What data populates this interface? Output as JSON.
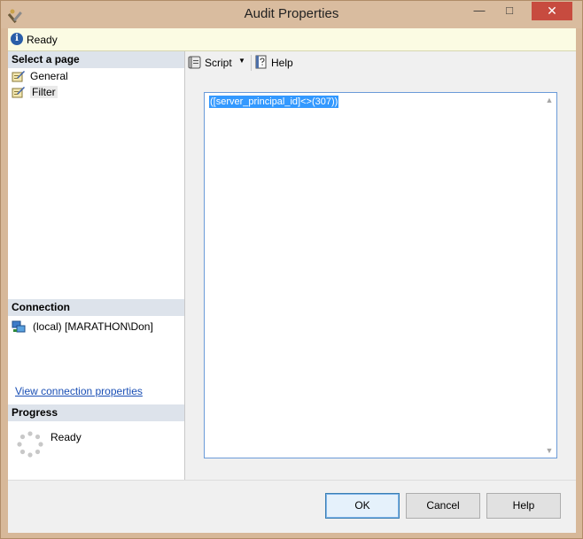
{
  "window": {
    "title": "Audit Properties",
    "close_glyph": "✕",
    "minimize_glyph": "—",
    "maximize_glyph": "□"
  },
  "status": {
    "icon": "info-icon",
    "text": "Ready"
  },
  "left_pane": {
    "select_page_header": "Select a page",
    "pages": [
      {
        "label": "General",
        "icon": "page-icon"
      },
      {
        "label": "Filter",
        "icon": "page-icon",
        "selected": true
      }
    ],
    "connection_header": "Connection",
    "connection_server": "(local) [MARATHON\\Don]",
    "view_connection_link": "View connection properties",
    "progress_header": "Progress",
    "progress_status": "Ready"
  },
  "toolbar": {
    "script_label": "Script",
    "help_label": "Help"
  },
  "editor": {
    "filter_text": "([server_principal_id]<>(307))"
  },
  "buttons": {
    "ok": "OK",
    "cancel": "Cancel",
    "help": "Help"
  }
}
